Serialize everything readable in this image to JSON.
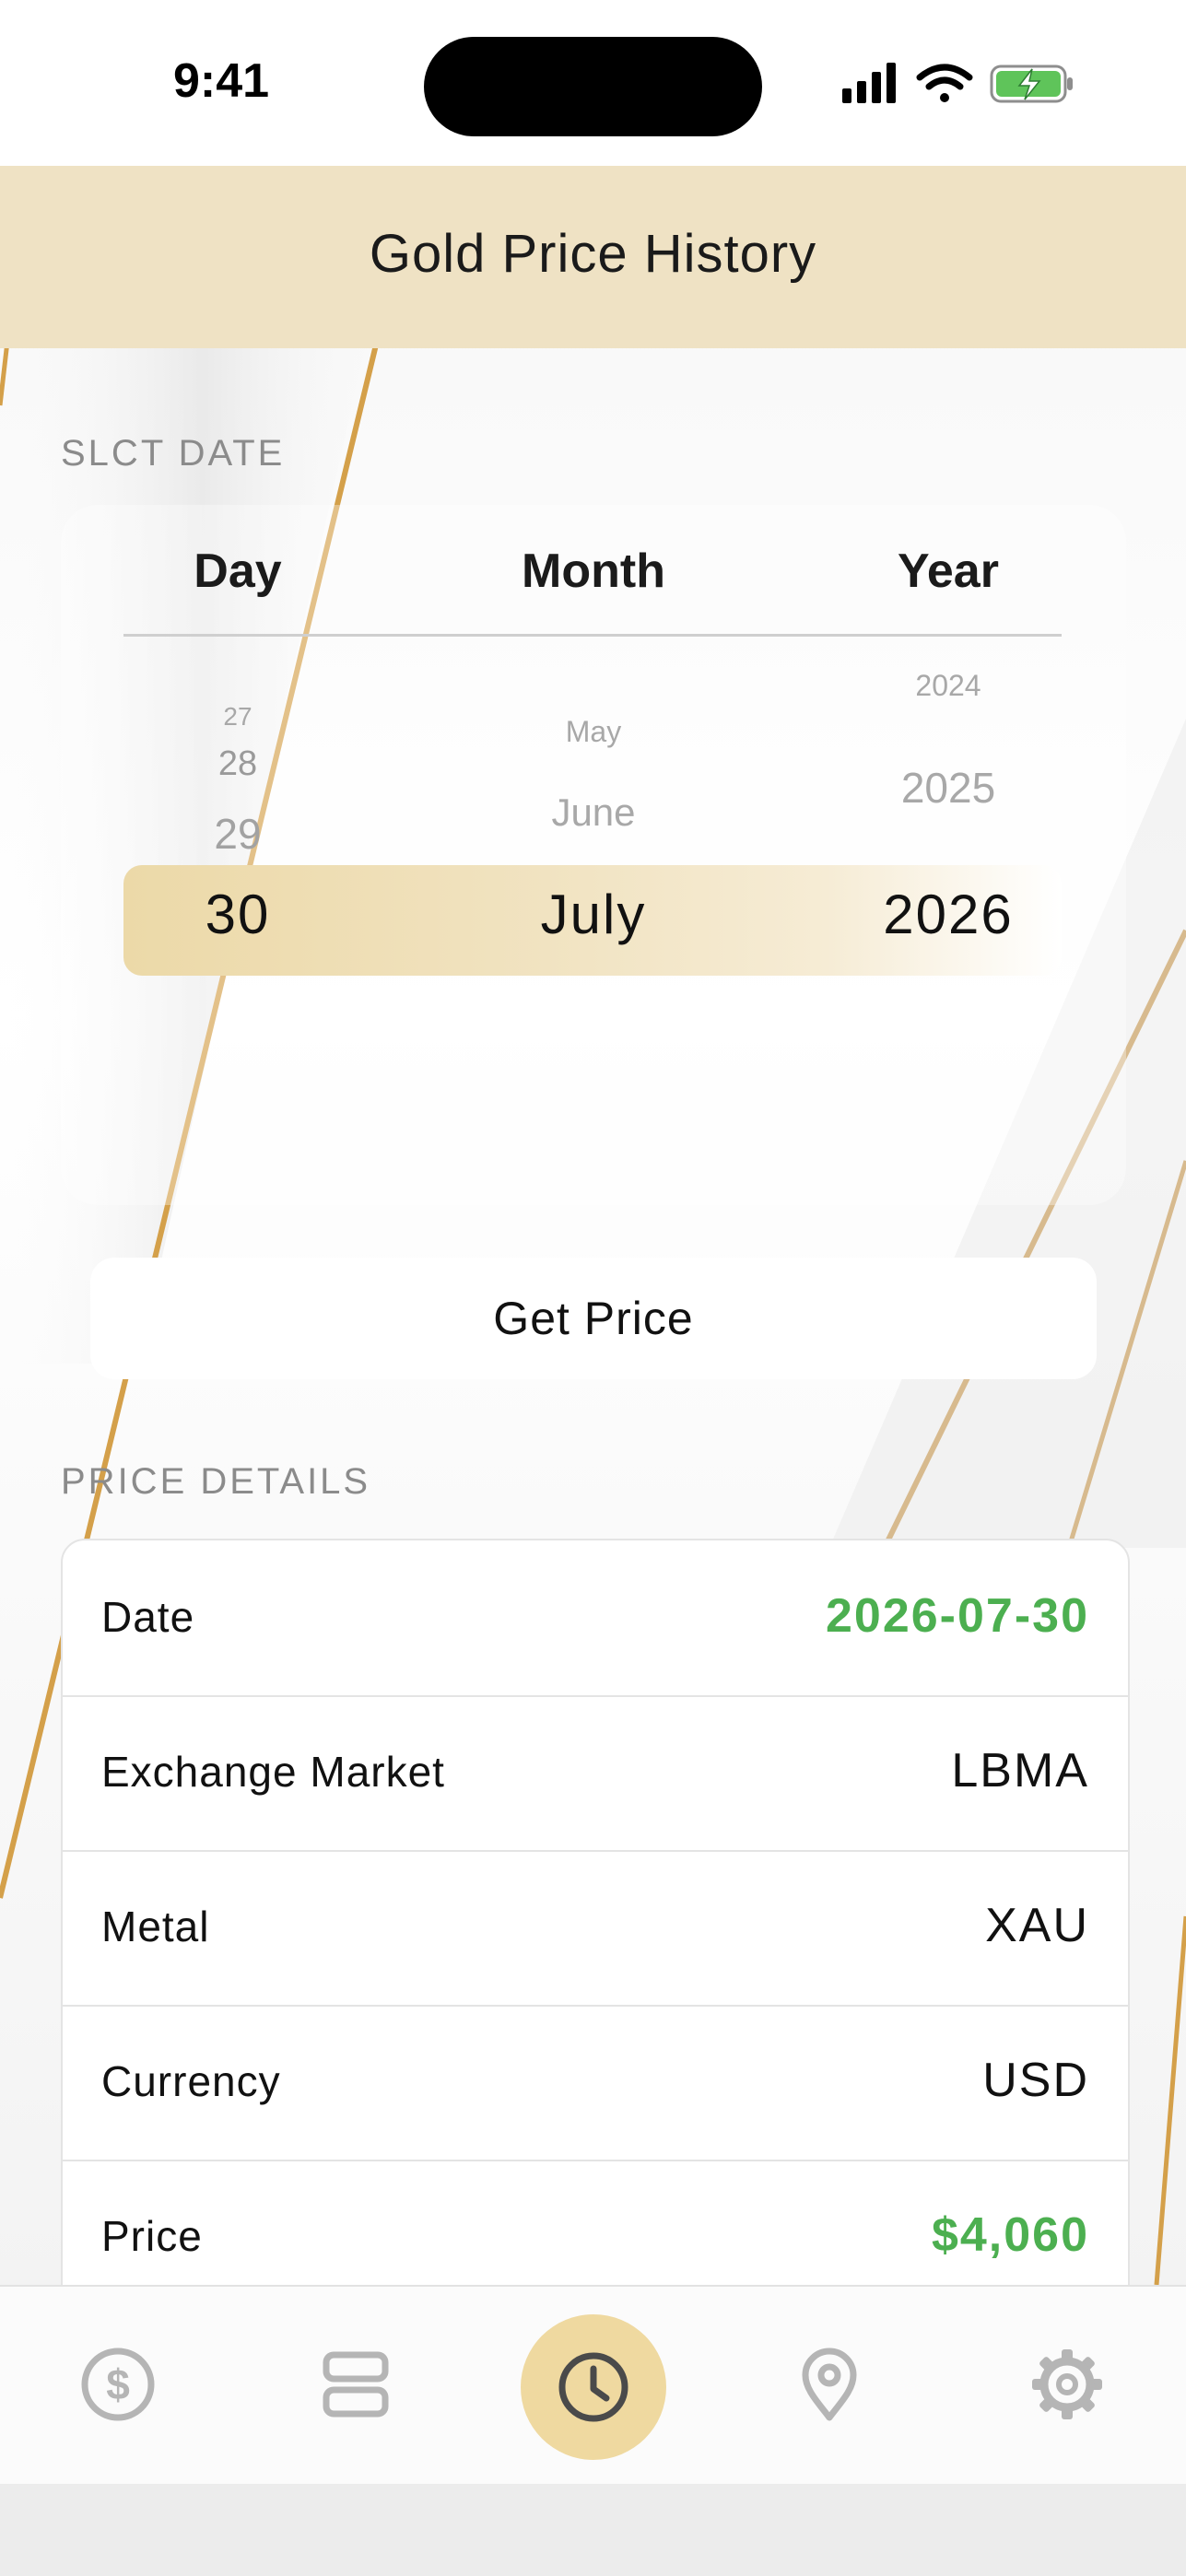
{
  "status_bar": {
    "time": "9:41"
  },
  "header": {
    "title": "Gold Price History"
  },
  "picker": {
    "section_label": "SLCT DATE",
    "columns": {
      "day": "Day",
      "month": "Month",
      "year": "Year"
    },
    "day_items": [
      "27",
      "28",
      "29"
    ],
    "month_items": [
      "May",
      "June"
    ],
    "year_items": [
      "2024",
      "2025"
    ],
    "selected": {
      "day": "30",
      "month": "July",
      "year": "2026"
    }
  },
  "get_price_button": "Get Price",
  "details": {
    "section_label": "PRICE DETAILS",
    "rows": [
      {
        "label": "Date",
        "value": "2026-07-30"
      },
      {
        "label": "Exchange Market",
        "value": "LBMA"
      },
      {
        "label": "Metal",
        "value": "XAU"
      },
      {
        "label": "Currency",
        "value": "USD"
      },
      {
        "label": "Price",
        "value": "$4,060"
      }
    ]
  },
  "tabs": [
    {
      "icon": "dollar-circle-icon"
    },
    {
      "icon": "stack-icon"
    },
    {
      "icon": "clock-icon"
    },
    {
      "icon": "location-pin-icon"
    },
    {
      "icon": "gear-icon"
    }
  ],
  "colors": {
    "accent_gold": "#efd9a0",
    "header_bg": "#efe2c4",
    "green": "#4caf50"
  }
}
